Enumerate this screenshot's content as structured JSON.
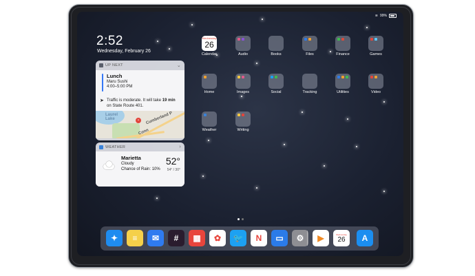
{
  "status": {
    "battery": "99%"
  },
  "lock": {
    "time": "2:52",
    "date": "Wednesday, February 26"
  },
  "up_next": {
    "header": "UP NEXT",
    "event_title": "Lunch",
    "event_place": "Maru Sushi",
    "event_time": "4:00–5:00 PM",
    "traffic_a": "Traffic is moderate. It will take ",
    "traffic_b": "19 min",
    "traffic_c": " on State Route 401.",
    "map_label_lake": "Laurel Lake",
    "map_label_road": "Cumberland P",
    "map_label_conn": "Conn"
  },
  "weather": {
    "header": "WEATHER",
    "city": "Marietta",
    "condition": "Cloudy",
    "rain": "Chance of Rain: 10%",
    "temp": "52°",
    "hilo": "54° / 30°"
  },
  "home_icons": [
    {
      "label": "Calendar",
      "kind": "calendar",
      "day": "Wednesday",
      "num": "26"
    },
    {
      "label": "Audio"
    },
    {
      "label": "Books"
    },
    {
      "label": "Files"
    },
    {
      "label": "Finance"
    },
    {
      "label": "Games"
    },
    {
      "label": "Home"
    },
    {
      "label": "Images"
    },
    {
      "label": "Social"
    },
    {
      "label": "Tracking"
    },
    {
      "label": "Utilities"
    },
    {
      "label": "Video"
    },
    {
      "label": "Weather"
    },
    {
      "label": "Writing"
    }
  ],
  "dock": {
    "calendar_num": "26",
    "calendar_day": "Wednesday",
    "apps": [
      {
        "name": "safari-icon",
        "color": "#1e8cf0"
      },
      {
        "name": "notes-icon",
        "color": "#f5d04a"
      },
      {
        "name": "mail-icon",
        "color": "#2f7bf0"
      },
      {
        "name": "slack-icon",
        "color": "#2a1c2e"
      },
      {
        "name": "fantastical-icon",
        "color": "#e8453c"
      },
      {
        "name": "photos-icon",
        "color": "#ffffff"
      },
      {
        "name": "twitter-icon",
        "color": "#1da1f2"
      },
      {
        "name": "news-icon",
        "color": "#ffffff"
      },
      {
        "name": "files-icon",
        "color": "#2b7be8"
      },
      {
        "name": "settings-icon",
        "color": "#8e8e93"
      },
      {
        "name": "infuse-icon",
        "color": "#f08a24"
      },
      {
        "name": "calendar-icon",
        "color": "#ffffff"
      },
      {
        "name": "app-store-icon",
        "color": "#1b8ef0"
      }
    ]
  }
}
